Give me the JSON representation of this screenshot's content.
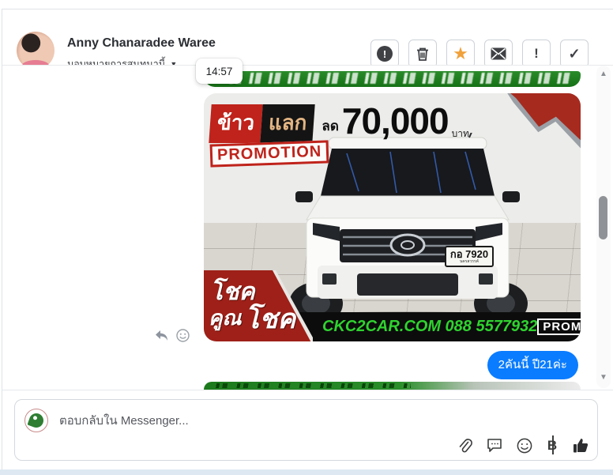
{
  "header": {
    "name": "Anny Chanaradee Waree",
    "assignment_label": "มอบหมายการสนทนานี้",
    "caret": "▼",
    "actions": {
      "report": "!",
      "star": "★",
      "exclamation": "!",
      "check": "✓"
    }
  },
  "tooltip": {
    "time": "14:57"
  },
  "ad": {
    "rice_label": "ข้าว",
    "exchange_label": "แลก",
    "discount_word": "ลด",
    "discount_amount": "70,000",
    "currency_label": "บาท",
    "promotion_stamp": "PROMOTION",
    "license_plate": "กอ 7920",
    "license_province": "นครสวรรค์",
    "luck_word_1": "โชค",
    "luck_word_2": "คูณ",
    "luck_word_3": "โชค",
    "contact": "CKC2CAR.COM 088 5577932",
    "promotion_tag": "PROMOTION"
  },
  "message": {
    "text": "2คันนี้ ปี21ค่ะ"
  },
  "composer": {
    "placeholder": "ตอบกลับใน Messenger..."
  },
  "scrollbar": {
    "up": "▲",
    "down": "▼"
  },
  "colors": {
    "messenger_blue": "#0a7cff",
    "banner_green": "#1e7e1e",
    "ad_red": "#bf231b",
    "badge_red": "#9e2018",
    "star_orange": "#f0a13a",
    "contact_green": "#2fd32f"
  }
}
